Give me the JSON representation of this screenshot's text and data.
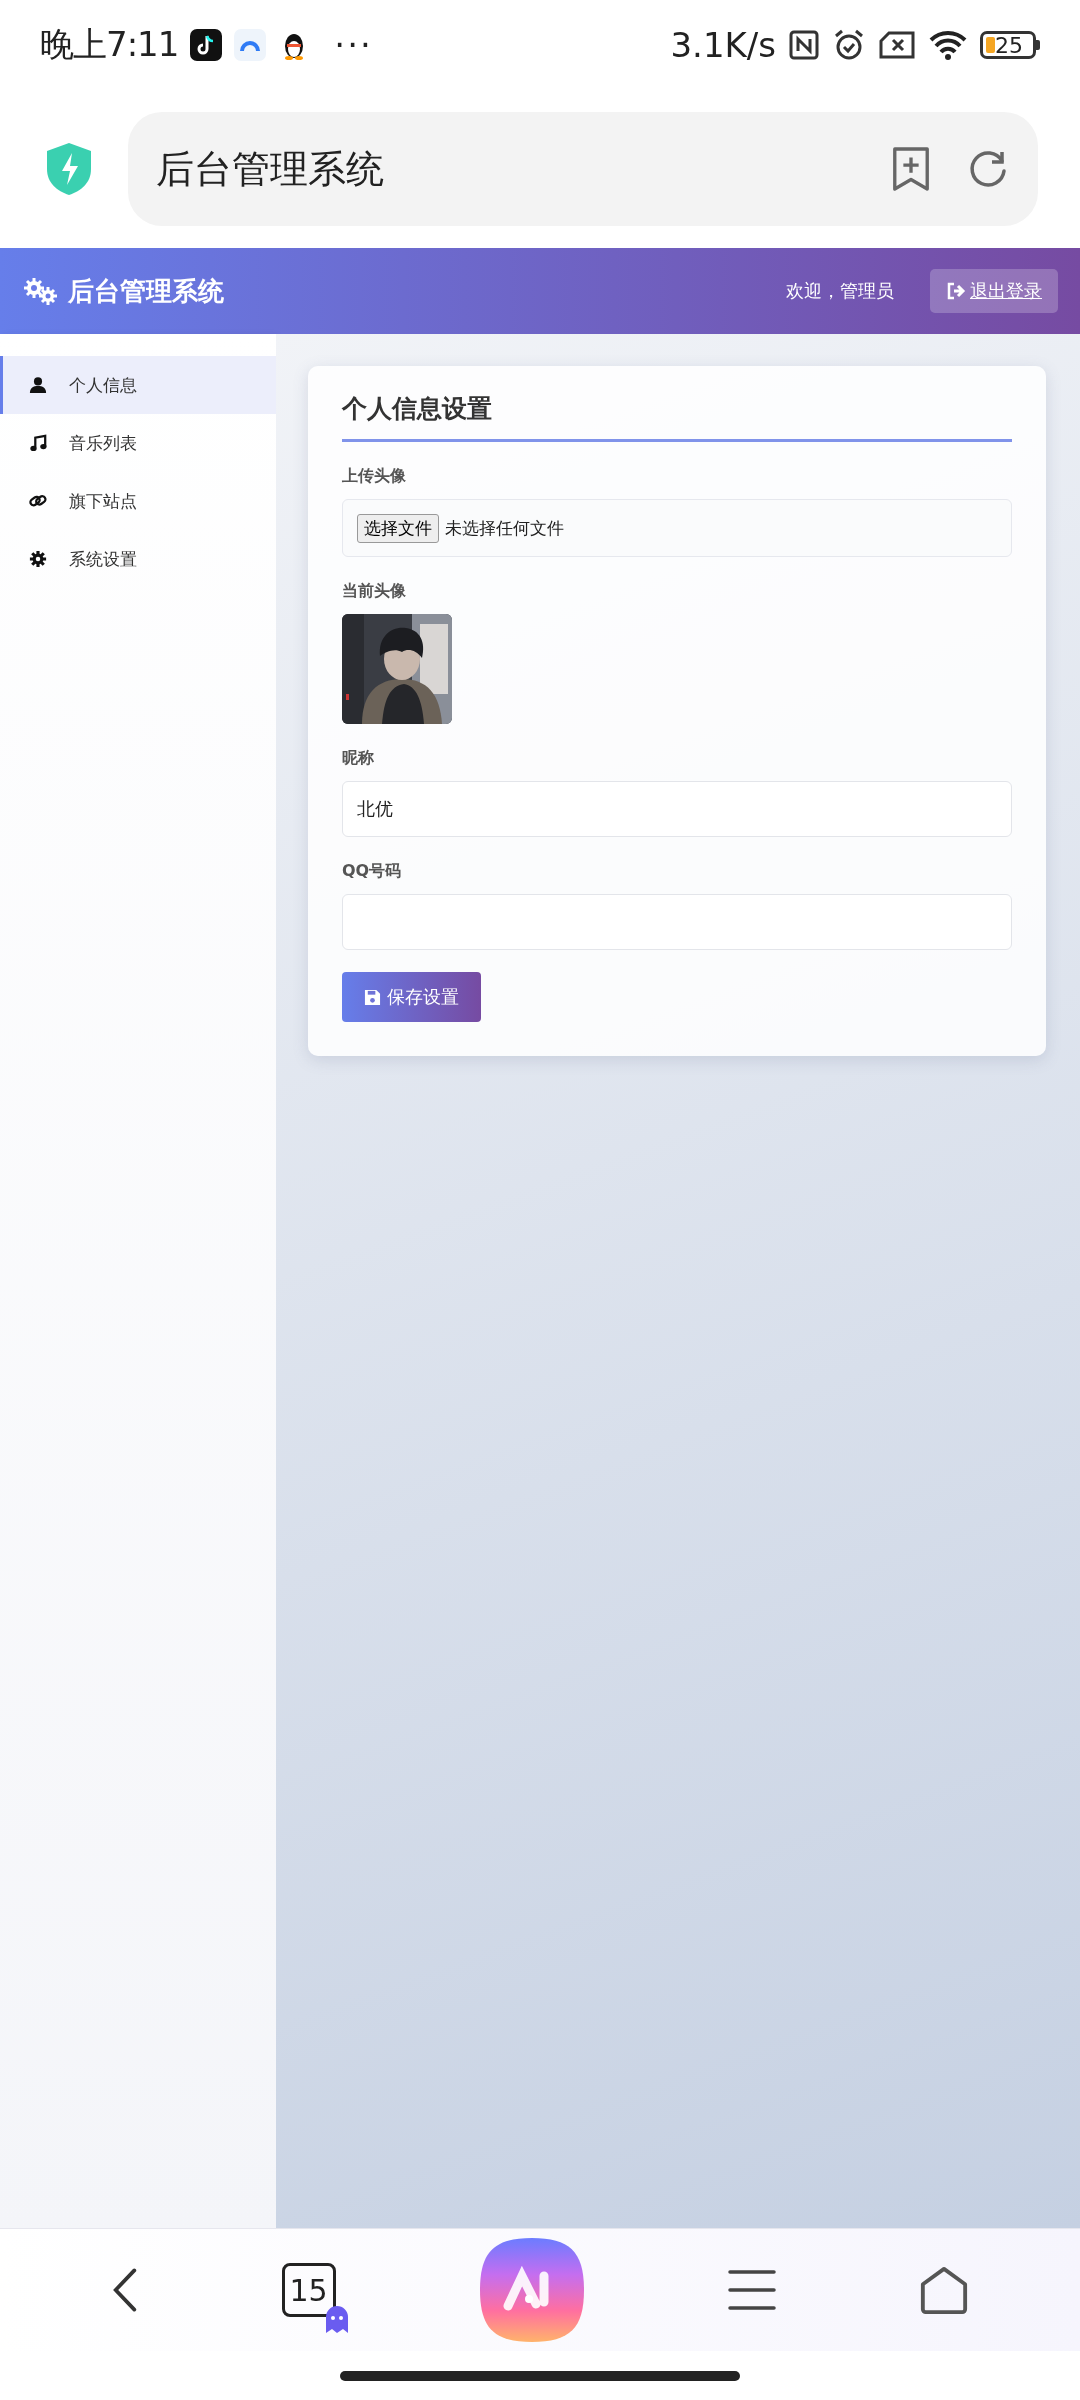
{
  "status_bar": {
    "time": "晚上7:11",
    "more": "···",
    "speed": "3.1K/s",
    "battery": "25"
  },
  "browser": {
    "address": "后台管理系统",
    "tab_count": "15"
  },
  "header": {
    "title": "后台管理系统",
    "welcome": "欢迎，管理员",
    "logout": "退出登录"
  },
  "sidebar": {
    "items": [
      {
        "label": "个人信息",
        "selected": true
      },
      {
        "label": "音乐列表",
        "selected": false
      },
      {
        "label": "旗下站点",
        "selected": false
      },
      {
        "label": "系统设置",
        "selected": false
      }
    ]
  },
  "form": {
    "title": "个人信息设置",
    "fields": [
      {
        "kind": "file",
        "label": "上传头像",
        "button": "选择文件",
        "status": "未选择任何文件"
      },
      {
        "kind": "avatar",
        "label": "当前头像"
      },
      {
        "kind": "text",
        "label": "昵称",
        "value": "北优"
      },
      {
        "kind": "text",
        "label": "QQ号码"
      }
    ],
    "save": "保存设置"
  }
}
